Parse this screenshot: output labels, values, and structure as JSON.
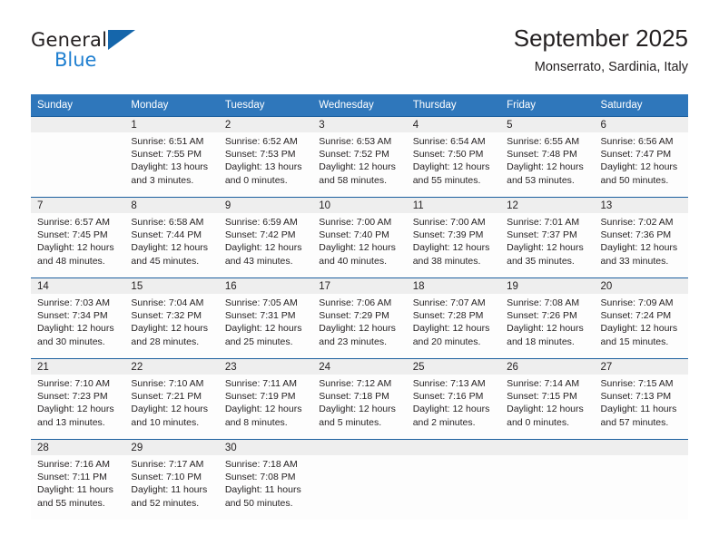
{
  "brand": {
    "name_part1": "General",
    "name_part2": "Blue",
    "triangle_color": "#1566ab",
    "blue_text_color": "#1f7fd0"
  },
  "header": {
    "title": "September 2025",
    "subtitle": "Monserrato, Sardinia, Italy",
    "accent_color": "#2f77bb",
    "row_divider_color": "#1c5f9e",
    "day_band_color": "#eeeeee"
  },
  "weekdays": [
    "Sunday",
    "Monday",
    "Tuesday",
    "Wednesday",
    "Thursday",
    "Friday",
    "Saturday"
  ],
  "weeks": [
    [
      {
        "day": "",
        "sunrise": "",
        "sunset": "",
        "daylight_line1": "",
        "daylight_line2": ""
      },
      {
        "day": "1",
        "sunrise": "Sunrise: 6:51 AM",
        "sunset": "Sunset: 7:55 PM",
        "daylight_line1": "Daylight: 13 hours",
        "daylight_line2": "and 3 minutes."
      },
      {
        "day": "2",
        "sunrise": "Sunrise: 6:52 AM",
        "sunset": "Sunset: 7:53 PM",
        "daylight_line1": "Daylight: 13 hours",
        "daylight_line2": "and 0 minutes."
      },
      {
        "day": "3",
        "sunrise": "Sunrise: 6:53 AM",
        "sunset": "Sunset: 7:52 PM",
        "daylight_line1": "Daylight: 12 hours",
        "daylight_line2": "and 58 minutes."
      },
      {
        "day": "4",
        "sunrise": "Sunrise: 6:54 AM",
        "sunset": "Sunset: 7:50 PM",
        "daylight_line1": "Daylight: 12 hours",
        "daylight_line2": "and 55 minutes."
      },
      {
        "day": "5",
        "sunrise": "Sunrise: 6:55 AM",
        "sunset": "Sunset: 7:48 PM",
        "daylight_line1": "Daylight: 12 hours",
        "daylight_line2": "and 53 minutes."
      },
      {
        "day": "6",
        "sunrise": "Sunrise: 6:56 AM",
        "sunset": "Sunset: 7:47 PM",
        "daylight_line1": "Daylight: 12 hours",
        "daylight_line2": "and 50 minutes."
      }
    ],
    [
      {
        "day": "7",
        "sunrise": "Sunrise: 6:57 AM",
        "sunset": "Sunset: 7:45 PM",
        "daylight_line1": "Daylight: 12 hours",
        "daylight_line2": "and 48 minutes."
      },
      {
        "day": "8",
        "sunrise": "Sunrise: 6:58 AM",
        "sunset": "Sunset: 7:44 PM",
        "daylight_line1": "Daylight: 12 hours",
        "daylight_line2": "and 45 minutes."
      },
      {
        "day": "9",
        "sunrise": "Sunrise: 6:59 AM",
        "sunset": "Sunset: 7:42 PM",
        "daylight_line1": "Daylight: 12 hours",
        "daylight_line2": "and 43 minutes."
      },
      {
        "day": "10",
        "sunrise": "Sunrise: 7:00 AM",
        "sunset": "Sunset: 7:40 PM",
        "daylight_line1": "Daylight: 12 hours",
        "daylight_line2": "and 40 minutes."
      },
      {
        "day": "11",
        "sunrise": "Sunrise: 7:00 AM",
        "sunset": "Sunset: 7:39 PM",
        "daylight_line1": "Daylight: 12 hours",
        "daylight_line2": "and 38 minutes."
      },
      {
        "day": "12",
        "sunrise": "Sunrise: 7:01 AM",
        "sunset": "Sunset: 7:37 PM",
        "daylight_line1": "Daylight: 12 hours",
        "daylight_line2": "and 35 minutes."
      },
      {
        "day": "13",
        "sunrise": "Sunrise: 7:02 AM",
        "sunset": "Sunset: 7:36 PM",
        "daylight_line1": "Daylight: 12 hours",
        "daylight_line2": "and 33 minutes."
      }
    ],
    [
      {
        "day": "14",
        "sunrise": "Sunrise: 7:03 AM",
        "sunset": "Sunset: 7:34 PM",
        "daylight_line1": "Daylight: 12 hours",
        "daylight_line2": "and 30 minutes."
      },
      {
        "day": "15",
        "sunrise": "Sunrise: 7:04 AM",
        "sunset": "Sunset: 7:32 PM",
        "daylight_line1": "Daylight: 12 hours",
        "daylight_line2": "and 28 minutes."
      },
      {
        "day": "16",
        "sunrise": "Sunrise: 7:05 AM",
        "sunset": "Sunset: 7:31 PM",
        "daylight_line1": "Daylight: 12 hours",
        "daylight_line2": "and 25 minutes."
      },
      {
        "day": "17",
        "sunrise": "Sunrise: 7:06 AM",
        "sunset": "Sunset: 7:29 PM",
        "daylight_line1": "Daylight: 12 hours",
        "daylight_line2": "and 23 minutes."
      },
      {
        "day": "18",
        "sunrise": "Sunrise: 7:07 AM",
        "sunset": "Sunset: 7:28 PM",
        "daylight_line1": "Daylight: 12 hours",
        "daylight_line2": "and 20 minutes."
      },
      {
        "day": "19",
        "sunrise": "Sunrise: 7:08 AM",
        "sunset": "Sunset: 7:26 PM",
        "daylight_line1": "Daylight: 12 hours",
        "daylight_line2": "and 18 minutes."
      },
      {
        "day": "20",
        "sunrise": "Sunrise: 7:09 AM",
        "sunset": "Sunset: 7:24 PM",
        "daylight_line1": "Daylight: 12 hours",
        "daylight_line2": "and 15 minutes."
      }
    ],
    [
      {
        "day": "21",
        "sunrise": "Sunrise: 7:10 AM",
        "sunset": "Sunset: 7:23 PM",
        "daylight_line1": "Daylight: 12 hours",
        "daylight_line2": "and 13 minutes."
      },
      {
        "day": "22",
        "sunrise": "Sunrise: 7:10 AM",
        "sunset": "Sunset: 7:21 PM",
        "daylight_line1": "Daylight: 12 hours",
        "daylight_line2": "and 10 minutes."
      },
      {
        "day": "23",
        "sunrise": "Sunrise: 7:11 AM",
        "sunset": "Sunset: 7:19 PM",
        "daylight_line1": "Daylight: 12 hours",
        "daylight_line2": "and 8 minutes."
      },
      {
        "day": "24",
        "sunrise": "Sunrise: 7:12 AM",
        "sunset": "Sunset: 7:18 PM",
        "daylight_line1": "Daylight: 12 hours",
        "daylight_line2": "and 5 minutes."
      },
      {
        "day": "25",
        "sunrise": "Sunrise: 7:13 AM",
        "sunset": "Sunset: 7:16 PM",
        "daylight_line1": "Daylight: 12 hours",
        "daylight_line2": "and 2 minutes."
      },
      {
        "day": "26",
        "sunrise": "Sunrise: 7:14 AM",
        "sunset": "Sunset: 7:15 PM",
        "daylight_line1": "Daylight: 12 hours",
        "daylight_line2": "and 0 minutes."
      },
      {
        "day": "27",
        "sunrise": "Sunrise: 7:15 AM",
        "sunset": "Sunset: 7:13 PM",
        "daylight_line1": "Daylight: 11 hours",
        "daylight_line2": "and 57 minutes."
      }
    ],
    [
      {
        "day": "28",
        "sunrise": "Sunrise: 7:16 AM",
        "sunset": "Sunset: 7:11 PM",
        "daylight_line1": "Daylight: 11 hours",
        "daylight_line2": "and 55 minutes."
      },
      {
        "day": "29",
        "sunrise": "Sunrise: 7:17 AM",
        "sunset": "Sunset: 7:10 PM",
        "daylight_line1": "Daylight: 11 hours",
        "daylight_line2": "and 52 minutes."
      },
      {
        "day": "30",
        "sunrise": "Sunrise: 7:18 AM",
        "sunset": "Sunset: 7:08 PM",
        "daylight_line1": "Daylight: 11 hours",
        "daylight_line2": "and 50 minutes."
      },
      {
        "day": "",
        "sunrise": "",
        "sunset": "",
        "daylight_line1": "",
        "daylight_line2": ""
      },
      {
        "day": "",
        "sunrise": "",
        "sunset": "",
        "daylight_line1": "",
        "daylight_line2": ""
      },
      {
        "day": "",
        "sunrise": "",
        "sunset": "",
        "daylight_line1": "",
        "daylight_line2": ""
      },
      {
        "day": "",
        "sunrise": "",
        "sunset": "",
        "daylight_line1": "",
        "daylight_line2": ""
      }
    ]
  ]
}
